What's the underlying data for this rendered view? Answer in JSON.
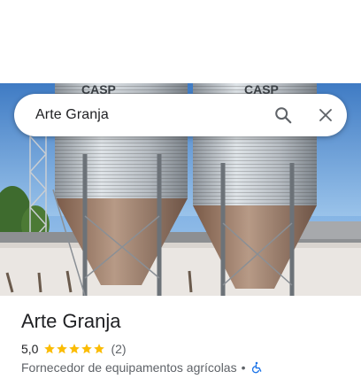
{
  "search": {
    "query": "Arte Granja",
    "search_icon": "search-icon",
    "close_icon": "close-icon"
  },
  "hero": {
    "image_subject": "grain silos",
    "silo_letters_left": "CASP",
    "silo_letters_right": "CASP"
  },
  "place": {
    "title": "Arte Granja",
    "rating": "5,0",
    "stars": 5,
    "review_count": "(2)",
    "category": "Fornecedor de equipamentos agrícolas",
    "separator": "•",
    "accessibility_icon": "wheelchair-icon"
  },
  "colors": {
    "star": "#fbbc04",
    "accessibility": "#1a73e8",
    "text_primary": "#202124",
    "text_secondary": "#5f6368"
  }
}
